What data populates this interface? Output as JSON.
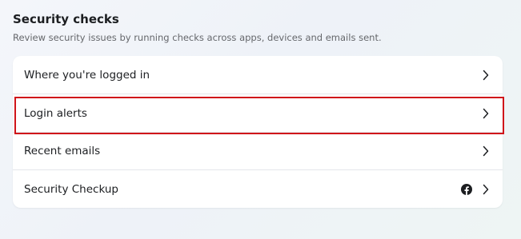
{
  "section": {
    "title": "Security checks",
    "subtitle": "Review security issues by running checks across apps, devices and emails sent."
  },
  "rows": [
    {
      "label": "Where you're logged in",
      "icon": "chevron-right-icon"
    },
    {
      "label": "Login alerts",
      "icon": "chevron-right-icon",
      "highlighted": true
    },
    {
      "label": "Recent emails",
      "icon": "chevron-right-icon"
    },
    {
      "label": "Security Checkup",
      "icon": "chevron-right-icon",
      "badge_icon": "facebook-icon"
    }
  ],
  "colors": {
    "highlight_border": "#d0141a",
    "text_primary": "#1c1e21",
    "text_secondary": "#65676b"
  }
}
